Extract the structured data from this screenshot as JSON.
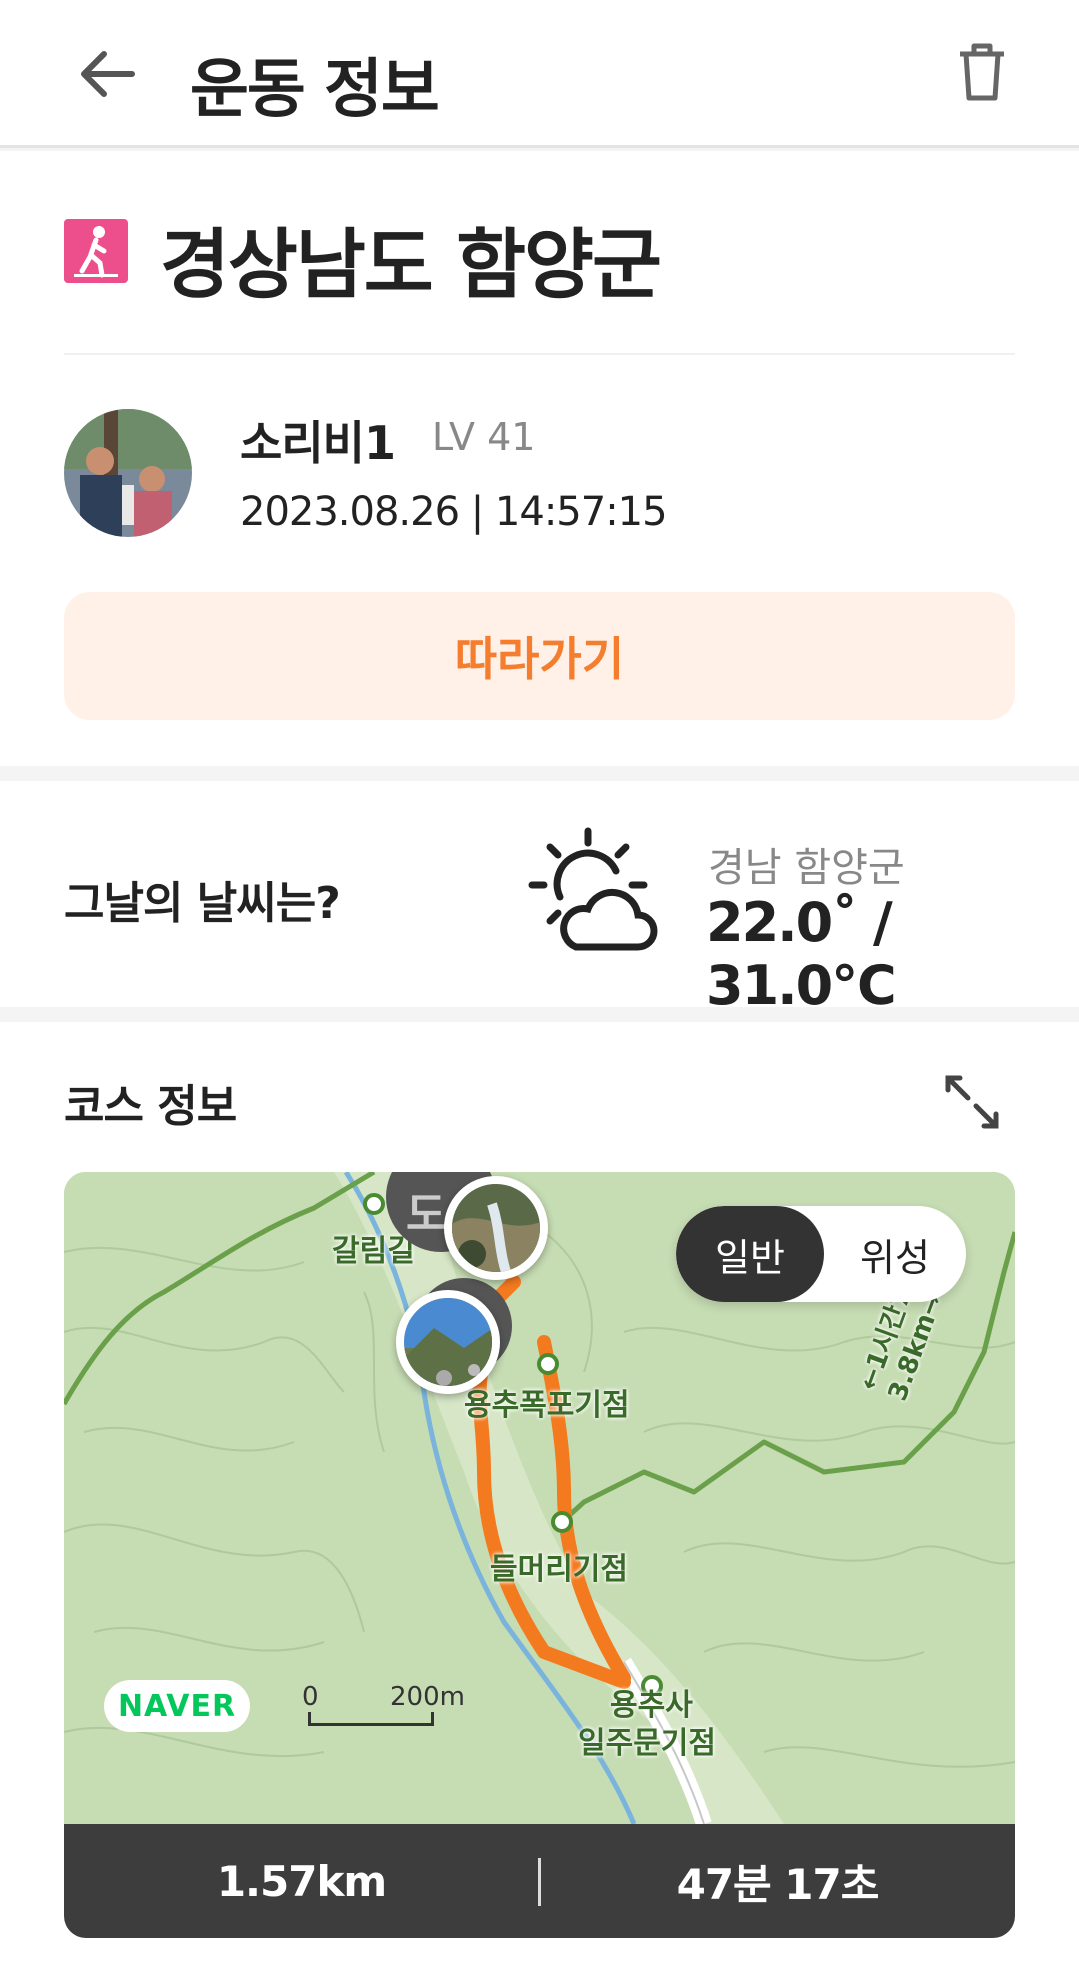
{
  "header": {
    "title": "운동 정보"
  },
  "activity": {
    "place": "경상남도 함양군",
    "user_name": "소리비1",
    "user_level": "LV 41",
    "datetime": "2023.08.26 | 14:57:15",
    "follow_label": "따라가기"
  },
  "weather": {
    "question": "그날의 날씨는?",
    "region": "경남 함양군",
    "temp": "22.0˚ / 31.0℃"
  },
  "course": {
    "title": "코스 정보",
    "toggle_normal": "일반",
    "toggle_satellite": "위성",
    "map_labels": {
      "galim": "갈림길",
      "yongchu_fall": "용추폭포기점",
      "deulmeori": "들머리기점",
      "yongchusa1": "용추사",
      "yongchusa2": "일주문기점",
      "trail": "←1시간7분 3.8km→",
      "do": "도"
    },
    "naver": "NAVER",
    "scale_zero": "0",
    "scale_dist": "200m",
    "distance": "1.57km",
    "duration": "47분 17초"
  },
  "colors": {
    "accent": "#f47d2e",
    "follow_bg": "#fff1e8",
    "walk_icon": "#ec4f8c",
    "stats_bg": "#3d3d3d"
  }
}
